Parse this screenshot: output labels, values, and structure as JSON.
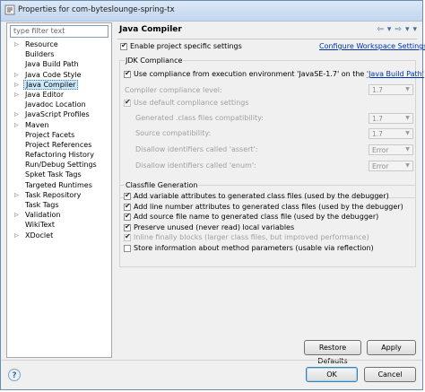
{
  "window": {
    "title": "Properties for com-byteslounge-spring-tx"
  },
  "filter": {
    "placeholder": "type filter text"
  },
  "tree": {
    "items": [
      {
        "label": "Resource",
        "expandable": true
      },
      {
        "label": "Builders",
        "expandable": false
      },
      {
        "label": "Java Build Path",
        "expandable": false
      },
      {
        "label": "Java Code Style",
        "expandable": true
      },
      {
        "label": "Java Compiler",
        "expandable": true,
        "selected": true
      },
      {
        "label": "Java Editor",
        "expandable": true
      },
      {
        "label": "Javadoc Location",
        "expandable": false
      },
      {
        "label": "JavaScript Profiles",
        "expandable": true
      },
      {
        "label": "Maven",
        "expandable": true
      },
      {
        "label": "Project Facets",
        "expandable": false
      },
      {
        "label": "Project References",
        "expandable": false
      },
      {
        "label": "Refactoring History",
        "expandable": false
      },
      {
        "label": "Run/Debug Settings",
        "expandable": false
      },
      {
        "label": "Spket Task Tags",
        "expandable": false
      },
      {
        "label": "Targeted Runtimes",
        "expandable": false
      },
      {
        "label": "Task Repository",
        "expandable": true
      },
      {
        "label": "Task Tags",
        "expandable": false
      },
      {
        "label": "Validation",
        "expandable": true
      },
      {
        "label": "WikiText",
        "expandable": false
      },
      {
        "label": "XDoclet",
        "expandable": true
      }
    ]
  },
  "page": {
    "title": "Java Compiler",
    "enable_project": {
      "label": "Enable project specific settings",
      "checked": true
    },
    "configure_link": "Configure Workspace Settings...",
    "jdk": {
      "group_title": "JDK Compliance",
      "use_compliance_prefix": "Use compliance from execution environment 'JavaSE-1.7' on the ",
      "use_compliance_link": "'Java Build Path'",
      "compiler_level_label": "Compiler compliance level:",
      "compiler_level_value": "1.7",
      "use_default_label": "Use default compliance settings",
      "generated_label": "Generated .class files compatibility:",
      "generated_value": "1.7",
      "source_label": "Source compatibility:",
      "source_value": "1.7",
      "assert_label": "Disallow identifiers called 'assert':",
      "assert_value": "Error",
      "enum_label": "Disallow identifiers called 'enum':",
      "enum_value": "Error"
    },
    "classfile": {
      "group_title": "Classfile Generation",
      "options": [
        {
          "label": "Add variable attributes to generated class files (used by the debugger)",
          "checked": true,
          "enabled": true
        },
        {
          "label": "Add line number attributes to generated class files (used by the debugger)",
          "checked": true,
          "enabled": true
        },
        {
          "label": "Add source file name to generated class file (used by the debugger)",
          "checked": true,
          "enabled": true
        },
        {
          "label": "Preserve unused (never read) local variables",
          "checked": true,
          "enabled": true
        },
        {
          "label": "Inline finally blocks (larger class files, but improved performance)",
          "checked": true,
          "enabled": false
        },
        {
          "label": "Store information about method parameters (usable via reflection)",
          "checked": false,
          "enabled": true
        }
      ]
    },
    "restore_defaults": "Restore Defaults",
    "apply": "Apply"
  },
  "footer": {
    "ok": "OK",
    "cancel": "Cancel",
    "help": "?"
  }
}
